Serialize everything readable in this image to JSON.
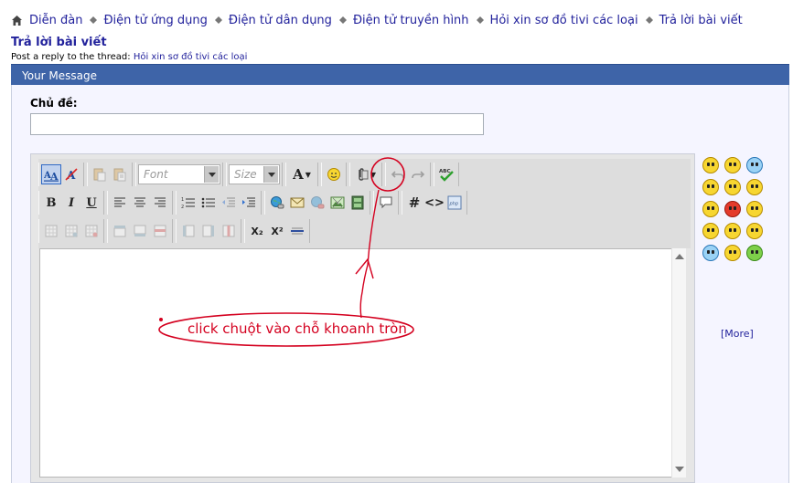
{
  "breadcrumb": [
    "Diễn đàn",
    "Điện tử ứng dụng",
    "Điện tử dân dụng",
    "Điện tử truyền hình",
    "Hỏi xin sơ đồ tivi các loại",
    "Trả lời bài viết"
  ],
  "page": {
    "title": "Trả lời bài viết",
    "subtitle_prefix": "Post a reply to the thread: ",
    "subtitle_thread": "Hỏi xin sơ đồ tivi các loại"
  },
  "panel": {
    "header": "Your Message"
  },
  "subject": {
    "label": "Chủ đề:",
    "value": ""
  },
  "toolbar": {
    "font_placeholder": "Font",
    "size_placeholder": "Size",
    "font_color_glyph": "A",
    "bold": "B",
    "italic": "I",
    "underline": "U",
    "code_glyph": "#",
    "html_glyph": "<>",
    "sub": "X₂",
    "sup": "X²"
  },
  "smilies": {
    "more_label": "[More]"
  },
  "annotation": {
    "text": "click chuột vào chỗ khoanh tròn",
    "color": "#d4001f"
  }
}
